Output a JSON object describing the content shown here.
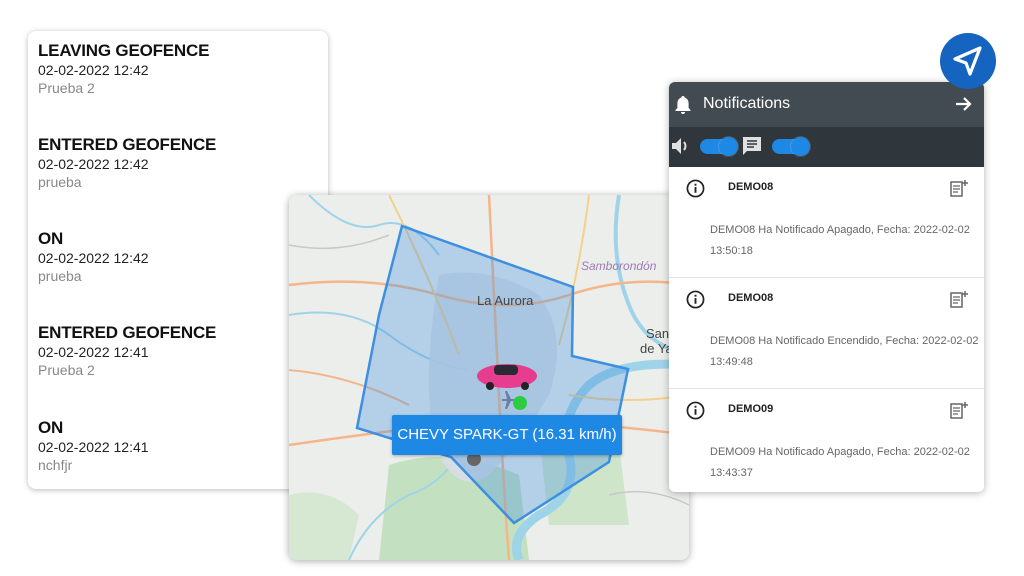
{
  "events": [
    {
      "title": "LEAVING GEOFENCE",
      "date": "02-02-2022 12:42",
      "sub": "Prueba 2"
    },
    {
      "title": "ENTERED GEOFENCE",
      "date": "02-02-2022 12:42",
      "sub": "prueba"
    },
    {
      "title": "ON",
      "date": "02-02-2022 12:42",
      "sub": "prueba"
    },
    {
      "title": "ENTERED GEOFENCE",
      "date": "02-02-2022 12:41",
      "sub": "Prueba 2"
    },
    {
      "title": "ON",
      "date": "02-02-2022 12:41",
      "sub": "nchfjr"
    }
  ],
  "map": {
    "labels": {
      "samborondon": "Samborondón",
      "la_aurora": "La Aurora",
      "san1": "San",
      "san2": "de Ya"
    },
    "tooltip": "CHEVY SPARK-GT (16.31 km/h)"
  },
  "notifications": {
    "title": "Notifications",
    "items": [
      {
        "name": "DEMO08",
        "msg_line1": "DEMO08 Ha Notificado Apagado, Fecha: 2022-02-02",
        "msg_line2": "13:50:18"
      },
      {
        "name": "DEMO08",
        "msg_line1": "DEMO08 Ha Notificado Encendido, Fecha: 2022-02-02",
        "msg_line2": "13:49:48"
      },
      {
        "name": "DEMO09",
        "msg_line1": "DEMO09 Ha Notificado Apagado, Fecha: 2022-02-02",
        "msg_line2": "13:43:37"
      }
    ]
  },
  "icons": {
    "bell": "bell-icon",
    "arrow": "arrow-right-icon",
    "sound": "volume-icon",
    "message": "message-icon",
    "info": "info-icon",
    "add_note": "note-add-icon",
    "navigate": "navigation-arrow-icon"
  },
  "colors": {
    "accent": "#1e88e5",
    "header": "#424a52",
    "toolbar": "#2f363c",
    "geofence": "#3d8fe0",
    "nav_button": "#1565c0"
  }
}
